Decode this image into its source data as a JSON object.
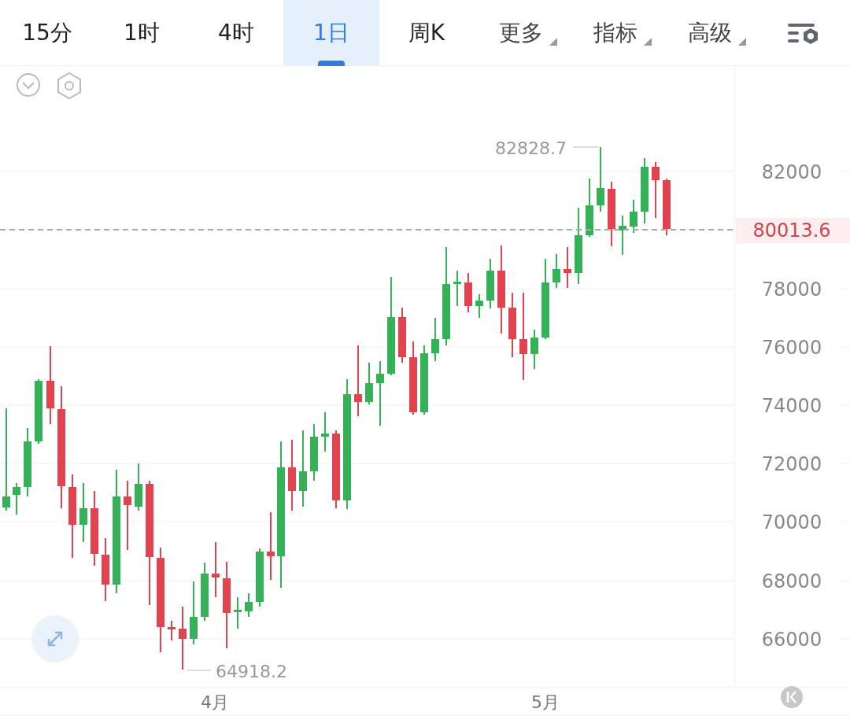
{
  "tabs": [
    {
      "label": "15分",
      "selected": false,
      "dropdown": false
    },
    {
      "label": "1时",
      "selected": false,
      "dropdown": false
    },
    {
      "label": "4时",
      "selected": false,
      "dropdown": false
    },
    {
      "label": "1日",
      "selected": true,
      "dropdown": false
    },
    {
      "label": "周K",
      "selected": false,
      "dropdown": false
    },
    {
      "label": "更多",
      "selected": false,
      "dropdown": true
    },
    {
      "label": "指标",
      "selected": false,
      "dropdown": true
    },
    {
      "label": "高级",
      "selected": false,
      "dropdown": true
    }
  ],
  "chart": {
    "y_axis_labels": [
      "82000",
      "78000",
      "76000",
      "74000",
      "72000",
      "70000",
      "68000",
      "66000"
    ],
    "current_price": "80013.6",
    "high_label": "82828.7",
    "low_label": "64918.2",
    "x_axis_labels": [
      "4月",
      "5月"
    ]
  }
}
